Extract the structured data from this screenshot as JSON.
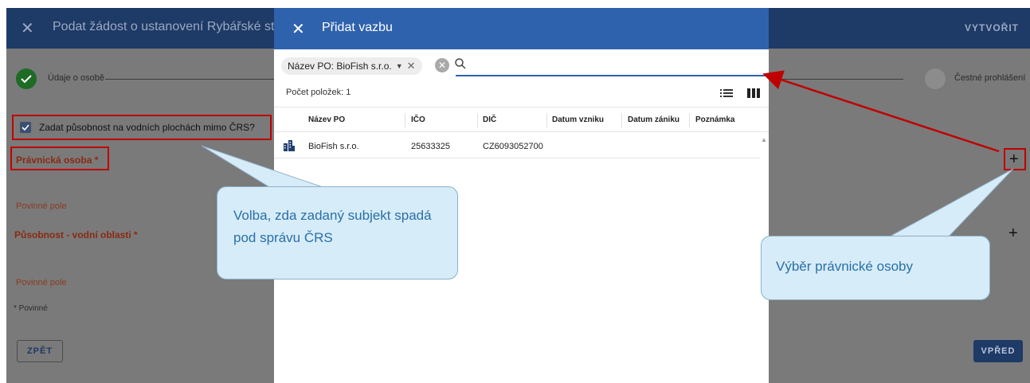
{
  "background_app": {
    "title": "Podat žádost o ustanovení Rybářské st",
    "create_label": "VYTVOŘIT",
    "steps": [
      {
        "label": "Údaje o osobě",
        "status": "done"
      },
      {
        "label": "Čestné prohlášení",
        "status": "pending"
      }
    ],
    "checkbox": {
      "label": "Zadat působnost na vodních plochách mimo ČRS?",
      "checked": true
    },
    "legal_entity_label": "Právnická osoba *",
    "required_field_1": "Povinné pole",
    "water_area_label": "Působnost - vodní oblasti *",
    "required_field_2": "Povinné pole",
    "required_note": "* Povinné",
    "back_label": "ZPĚT",
    "next_label": "VPŘED",
    "add_icon": "plus-icon"
  },
  "modal": {
    "title": "Přidat vazbu",
    "filter_chip": "Název PO: BioFish s.r.o.",
    "search": {
      "value": "",
      "placeholder": ""
    },
    "count_label": "Počet položek: 1",
    "columns": [
      "Název PO",
      "IČO",
      "DIČ",
      "Datum vzniku",
      "Datum zániku",
      "Poznámka"
    ],
    "rows": [
      {
        "name": "BioFish s.r.o.",
        "ico": "25633325",
        "dic": "CZ6093052700",
        "date_from": "",
        "date_to": "",
        "note": ""
      }
    ]
  },
  "callouts": {
    "checkbox_note": "Volba, zda zadaný subjekt spadá pod správu ČRS",
    "entity_note": "Výběr právnické osoby"
  },
  "colors": {
    "modal_header": "#2f62ad",
    "app_header": "#1e3a66",
    "highlight": "#c00000",
    "callout_fill": "#d6ecf8",
    "callout_text": "#2a6fa8"
  }
}
